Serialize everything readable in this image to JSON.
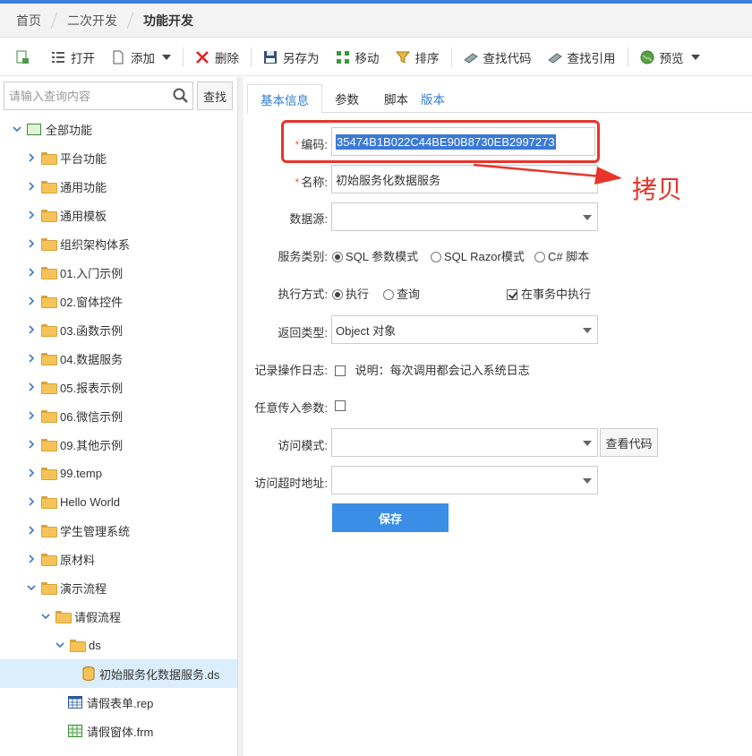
{
  "breadcrumb": [
    "首页",
    "二次开发",
    "功能开发"
  ],
  "toolbar": {
    "open": "打开",
    "add": "添加",
    "delete": "删除",
    "save_as": "另存为",
    "move": "移动",
    "sort": "排序",
    "find_code": "查找代码",
    "find_ref": "查找引用",
    "preview": "预览"
  },
  "search": {
    "placeholder": "请输入查询内容",
    "button": "查找"
  },
  "tree": {
    "root": "全部功能",
    "items": [
      "平台功能",
      "通用功能",
      "通用模板",
      "组织架构体系",
      "01.入门示例",
      "02.窗体控件",
      "03.函数示例",
      "04.数据服务",
      "05.报表示例",
      "06.微信示例",
      "09.其他示例",
      "99.temp",
      "Hello World",
      "学生管理系统",
      "原材料"
    ],
    "demo": "演示流程",
    "leave": "请假流程",
    "ds_folder": "ds",
    "ds_file": "初始服务化数据服务.ds",
    "rep_file": "请假表单.rep",
    "frm_file": "请假窗体.frm"
  },
  "tabs": [
    "基本信息",
    "参数",
    "脚本",
    "版本"
  ],
  "form": {
    "code_label": "编码:",
    "code_value": "35474B1B022C44BE90B8730EB2997273",
    "name_label": "名称:",
    "name_value": "初始服务化数据服务",
    "datasource_label": "数据源:",
    "service_type_label": "服务类别:",
    "service_types": [
      "SQL 参数模式",
      "SQL Razor模式",
      "C# 脚本"
    ],
    "exec_label": "执行方式:",
    "exec_modes": [
      "执行",
      "查询"
    ],
    "transaction": "在事务中执行",
    "return_label": "返回类型:",
    "return_value": "Object 对象",
    "log_label": "记录操作日志:",
    "log_desc": "说明：每次调用都会记入系统日志",
    "any_param_label": "任意传入参数:",
    "access_label": "访问模式:",
    "view_code": "查看代码",
    "timeout_label": "访问超时地址:",
    "save": "保存"
  },
  "annotation": "拷贝",
  "colors": {
    "accent": "#3a8ee6",
    "annotation": "#e8342a",
    "selected_row": "#dceefb"
  }
}
